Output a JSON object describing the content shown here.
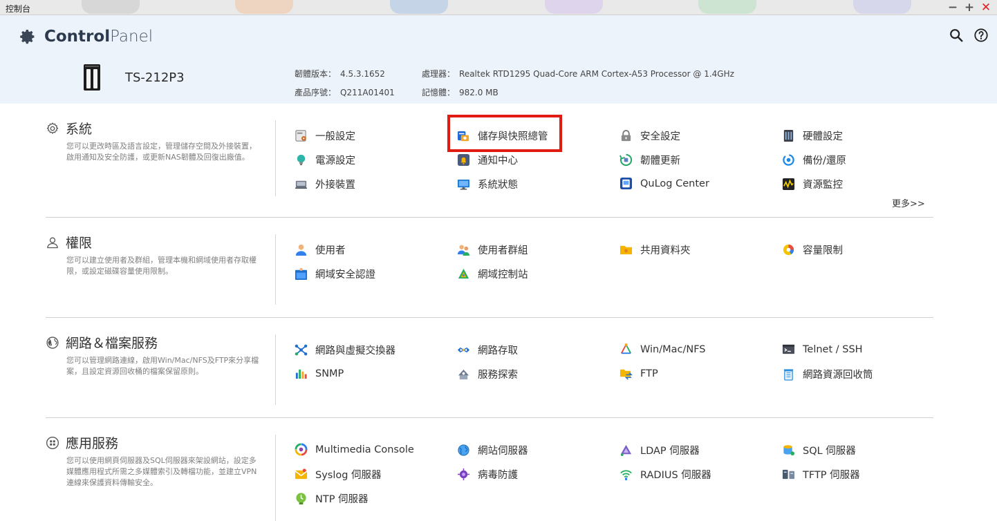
{
  "window": {
    "title": "控制台",
    "controls": [
      "−",
      "+",
      "✕"
    ]
  },
  "header": {
    "brand_bold": "Control",
    "brand_light": "Panel",
    "model": "TS-212P3",
    "specs": {
      "firmware_label": "韌體版本：",
      "firmware_value": "4.5.3.1652",
      "serial_label": "產品序號：",
      "serial_value": "Q211A01401",
      "cpu_label": "處理器：",
      "cpu_value": "Realtek RTD1295 Quad-Core ARM Cortex-A53 Processor @ 1.4GHz",
      "memory_label": "記憶體：",
      "memory_value": "982.0 MB"
    }
  },
  "sections": {
    "system": {
      "title": "系統",
      "desc": "您可以更改時區及語言設定，管理儲存空間及外接裝置，啟用通知及安全防護，或更新NAS韌體及回復出廠值。",
      "items": [
        "一般設定",
        "儲存與快照總管",
        "安全設定",
        "硬體設定",
        "電源設定",
        "通知中心",
        "韌體更新",
        "備份/還原",
        "外接裝置",
        "系統狀態",
        "QuLog Center",
        "資源監控"
      ],
      "more": "更多>>"
    },
    "privilege": {
      "title": "權限",
      "desc": "您可以建立使用者及群組，管理本機和網域使用者存取權限，或設定磁碟容量使用限制。",
      "items": [
        "使用者",
        "使用者群組",
        "共用資料夾",
        "容量限制",
        "網域安全認證",
        "網域控制站"
      ]
    },
    "network": {
      "title": "網路＆檔案服務",
      "desc": "您可以管理網路連線，啟用Win/Mac/NFS及FTP來分享檔案，且設定資源回收桶的檔案保留原則。",
      "items": [
        "網路與虛擬交換器",
        "網路存取",
        "Win/Mac/NFS",
        "Telnet / SSH",
        "SNMP",
        "服務探索",
        "FTP",
        "網路資源回收筒"
      ]
    },
    "apps": {
      "title": "應用服務",
      "desc": "您可以使用網頁伺服器及SQL伺服器來架設網站，設定多媒體應用程式所需之多媒體索引及轉檔功能，並建立VPN連線來保護資料傳輸安全。",
      "items": [
        "Multimedia Console",
        "網站伺服器",
        "LDAP 伺服器",
        "SQL 伺服器",
        "Syslog 伺服器",
        "病毒防護",
        "RADIUS 伺服器",
        "TFTP 伺服器",
        "NTP 伺服器"
      ]
    }
  },
  "colors": {
    "accent": "#e01c12",
    "header_bg": "#edf3fb",
    "divider": "#d0d0d0"
  }
}
